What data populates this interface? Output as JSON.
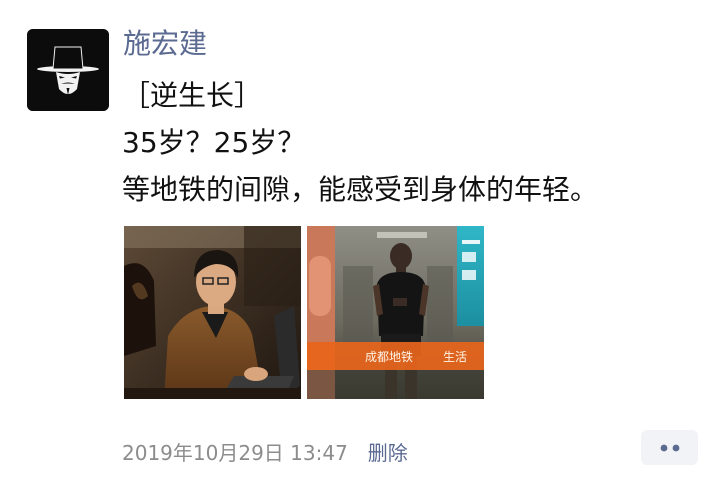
{
  "author": {
    "name": "施宏建",
    "avatar_icon": "masked-hat-avatar-icon"
  },
  "post": {
    "lines": [
      "［逆生长］",
      "35岁？25岁？",
      "等地铁的间隙，能感受到身体的年轻。"
    ],
    "photos": [
      {
        "name": "photo-man-at-laptop"
      },
      {
        "name": "photo-subway-reflection",
        "sign_text": "成都地铁",
        "sign_text_2": "生活"
      }
    ]
  },
  "footer": {
    "timestamp": "2019年10月29日 13:47",
    "delete_label": "删除",
    "more_icon": "more-dots-icon"
  },
  "colors": {
    "name_link": "#5b6a91",
    "timestamp": "#8c8c8c",
    "more_button_bg": "#f1f3f6"
  }
}
